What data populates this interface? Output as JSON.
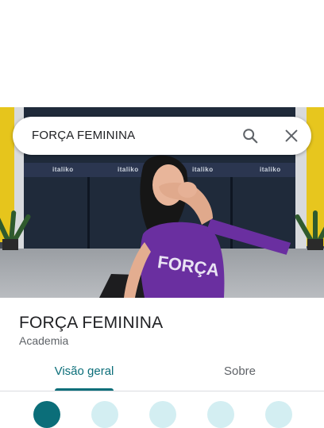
{
  "search": {
    "query": "FORÇA FEMININA"
  },
  "photo": {
    "storefront_text": [
      "italiko",
      "italiko",
      "italiko",
      "italiko"
    ],
    "shirt_text": "FORÇA"
  },
  "place": {
    "name": "FORÇA FEMININA",
    "category": "Academia"
  },
  "tabs": [
    {
      "label": "Visão geral",
      "selected": true
    },
    {
      "label": "Sobre",
      "selected": false
    }
  ],
  "actions": [
    {
      "icon": "directions-icon"
    },
    {
      "icon": "save-icon"
    },
    {
      "icon": "nearby-icon"
    },
    {
      "icon": "send-to-phone-icon"
    },
    {
      "icon": "share-icon"
    }
  ],
  "colors": {
    "accent": "#0b6e79",
    "action_secondary": "#d3eef2",
    "text_primary": "#202124",
    "text_secondary": "#5f6368",
    "shirt": "#6a2fa0",
    "beam": "#e6c51c"
  }
}
